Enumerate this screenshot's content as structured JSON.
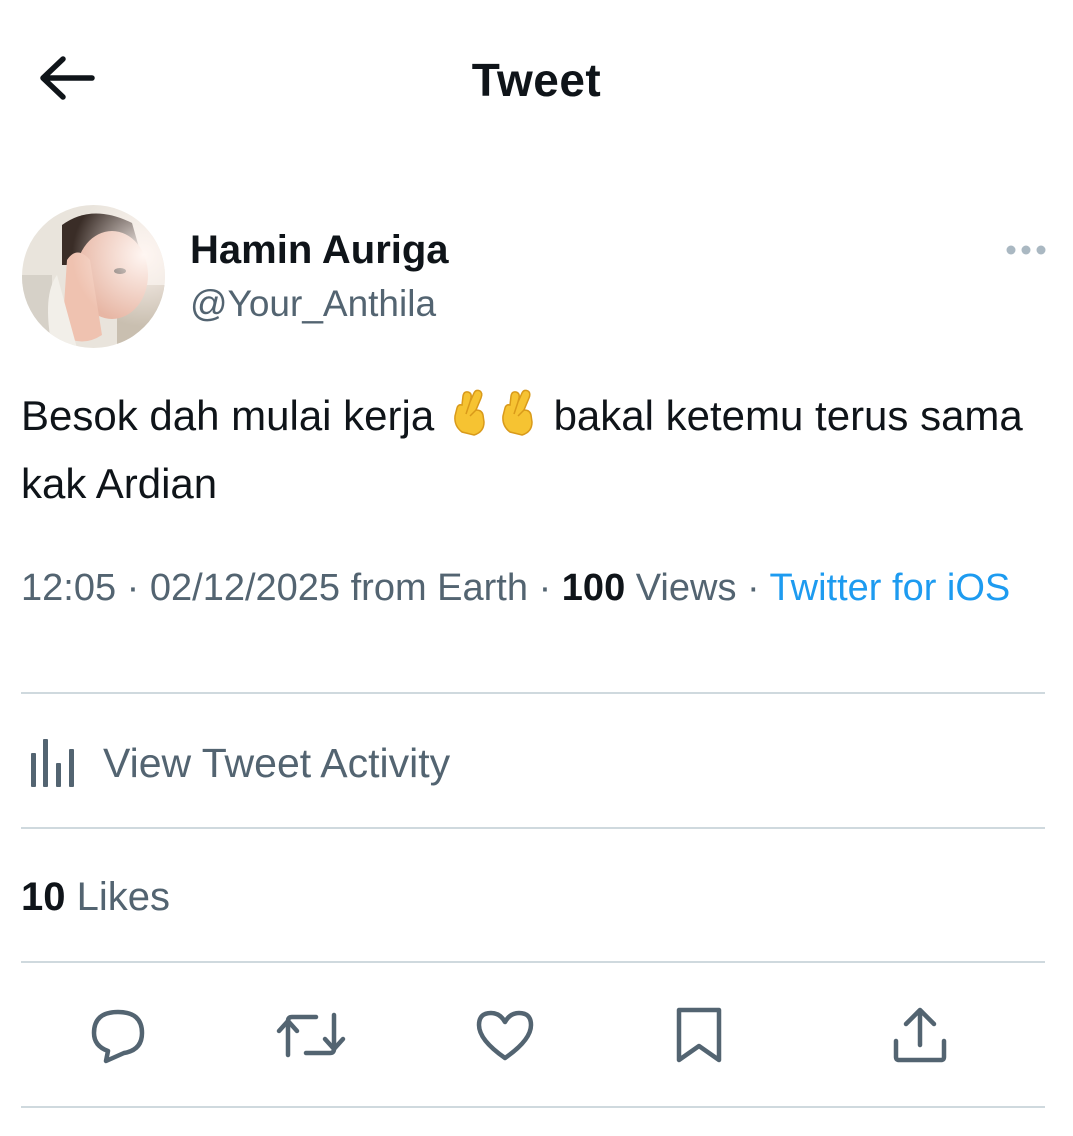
{
  "header": {
    "title": "Tweet",
    "back_icon": "arrow-left-icon"
  },
  "author": {
    "name": "Hamin Auriga",
    "handle": "@Your_Anthila",
    "more_icon": "more-dots-icon"
  },
  "tweet": {
    "text_part1": "Besok dah mulai kerja",
    "emoji": "crossed-fingers-emoji",
    "text_part2": "bakal ketemu terus sama kak Ardian"
  },
  "meta": {
    "time": "12:05",
    "separator": "·",
    "date": "02/12/2025 from Earth",
    "views_count": "100",
    "views_label": "Views",
    "source": "Twitter for iOS"
  },
  "activity": {
    "label": "View Tweet Activity",
    "icon": "bar-chart-icon"
  },
  "likes": {
    "count": "10",
    "label": "Likes"
  },
  "actions": [
    {
      "name": "reply",
      "icon": "reply-icon"
    },
    {
      "name": "retweet",
      "icon": "retweet-icon"
    },
    {
      "name": "like",
      "icon": "heart-icon"
    },
    {
      "name": "bookmark",
      "icon": "bookmark-icon"
    },
    {
      "name": "share",
      "icon": "share-icon"
    }
  ],
  "colors": {
    "text": "#0f1419",
    "secondary": "#536471",
    "link": "#1d9bf0",
    "divider": "#cfd9de",
    "emoji": "#f6c332"
  }
}
